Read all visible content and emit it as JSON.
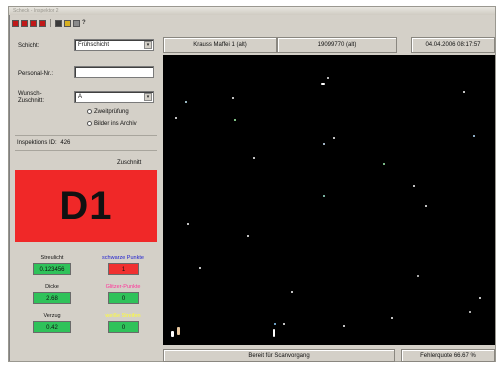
{
  "window": {
    "title": "Scheck - Inspektor 2"
  },
  "toolbar": {
    "buttons": [
      {
        "icon": "red-stop-icon",
        "color": "#c01818"
      },
      {
        "icon": "red-record-icon",
        "color": "#c01818"
      },
      {
        "icon": "red-pause-icon",
        "color": "#c01818"
      },
      {
        "icon": "red-flag-icon",
        "color": "#c01818"
      },
      {
        "icon": "dark-grid-icon",
        "color": "#3a3a3a"
      },
      {
        "icon": "yellow-folder-icon",
        "color": "#d8b020"
      },
      {
        "icon": "gray-tools-icon",
        "color": "#8a8a8a"
      }
    ],
    "help_label": "?"
  },
  "form": {
    "schicht_label": "Schicht:",
    "schicht_value": "Frühschicht",
    "personal_label": "Personal-Nr.:",
    "personal_value": "",
    "wunsch_label_1": "Wunsch-",
    "wunsch_label_2": "Zuschnitt:",
    "wunsch_value": "A",
    "radio1_label": "Zweitprüfung",
    "radio2_label": "Bilder ins Archiv",
    "inspektion_label": "Inspektions ID:",
    "inspektion_value": "426"
  },
  "zuschnitt": {
    "label": "Zuschnitt",
    "value": "D1"
  },
  "metrics": {
    "streulicht": {
      "label": "Streulicht",
      "value": "0.123456"
    },
    "schwarze": {
      "label": "schwarze Punkte",
      "value": "1",
      "color": "#2020d0"
    },
    "dicke": {
      "label": "Dicke",
      "value": "2.68"
    },
    "glitzer": {
      "label": "Glitzer-Punkte",
      "value": "0",
      "color": "#ff3399"
    },
    "verzug": {
      "label": "Verzug",
      "value": "0.42"
    },
    "weisse": {
      "label": "weiße Streifen",
      "value": "0",
      "color": "#ffff33"
    }
  },
  "header": {
    "machine": "Krauss Maffei 1 (alt)",
    "part": "19099770 (alt)",
    "datetime": "04.04.2006  08:17:57"
  },
  "status": {
    "message": "Bereit für Scanvorgang",
    "fehlerquote": "Fehlerquote 66.67 %"
  }
}
